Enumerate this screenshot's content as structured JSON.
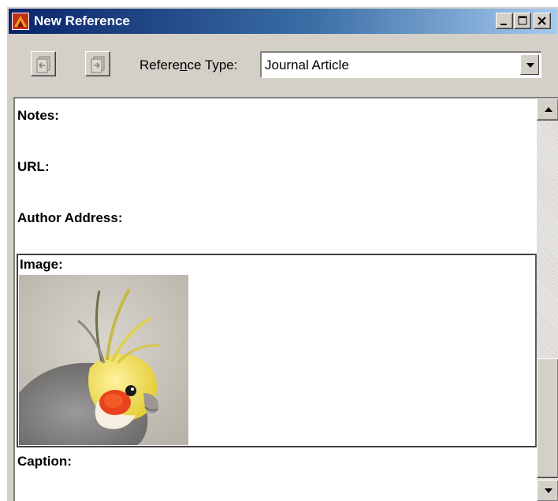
{
  "window": {
    "title": "New Reference",
    "controls": [
      "minimize",
      "maximize",
      "close"
    ]
  },
  "toolbar": {
    "reference_type_label_pre": "Refere",
    "reference_type_label_mnemonic": "n",
    "reference_type_label_post": "ce Type:",
    "reference_type_value": "Journal Article",
    "buttons": [
      "previous-reference-icon",
      "next-reference-icon"
    ]
  },
  "fields": {
    "notes": "Notes:",
    "url": "URL:",
    "author_address": "Author Address:",
    "image": "Image:",
    "caption": "Caption:"
  },
  "image": {
    "subject": "cockatiel-parrot"
  },
  "colors": {
    "title_bar_start": "#0a246a",
    "title_bar_end": "#a6caf0",
    "face": "#d4d0c8"
  }
}
